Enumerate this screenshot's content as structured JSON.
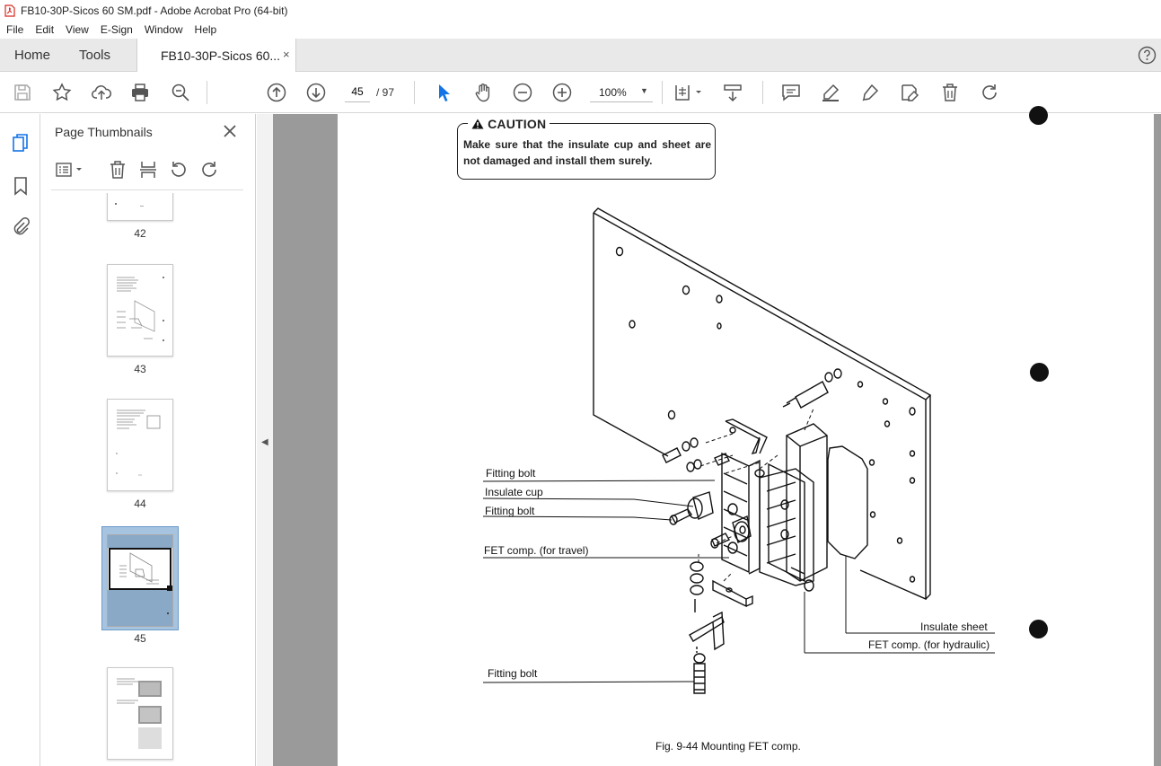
{
  "app": {
    "title": "FB10-30P-Sicos 60 SM.pdf - Adobe Acrobat Pro (64-bit)",
    "menu": [
      "File",
      "Edit",
      "View",
      "E-Sign",
      "Window",
      "Help"
    ]
  },
  "tabs": {
    "home": "Home",
    "tools": "Tools",
    "document": "FB10-30P-Sicos 60...",
    "close_glyph": "×"
  },
  "toolbar": {
    "current_page": "45",
    "page_total": "/ 97",
    "zoom": "100%"
  },
  "panel": {
    "title": "Page Thumbnails",
    "thumbnails": [
      {
        "label": "42"
      },
      {
        "label": "43"
      },
      {
        "label": "44"
      },
      {
        "label": "45",
        "selected": true
      },
      {
        "label": ""
      }
    ]
  },
  "document": {
    "caution_title": "CAUTION",
    "caution_text": "Make sure that the insulate cup and sheet are not damaged and install them surely.",
    "labels": {
      "fitting_bolt_1": "Fitting bolt",
      "insulate_cup": "Insulate cup",
      "fitting_bolt_2": "Fitting bolt",
      "fet_travel": "FET comp. (for travel)",
      "fitting_bolt_3": "Fitting bolt",
      "insulate_sheet": "Insulate sheet",
      "fet_hydraulic": "FET comp. (for hydraulic)"
    },
    "caption": "Fig. 9-44 Mounting FET comp."
  },
  "colors": {
    "accent": "#1473e6",
    "selection": "#a6c3e0",
    "doc_background": "#9a9a9a",
    "pdf_icon": "#d7281e"
  }
}
